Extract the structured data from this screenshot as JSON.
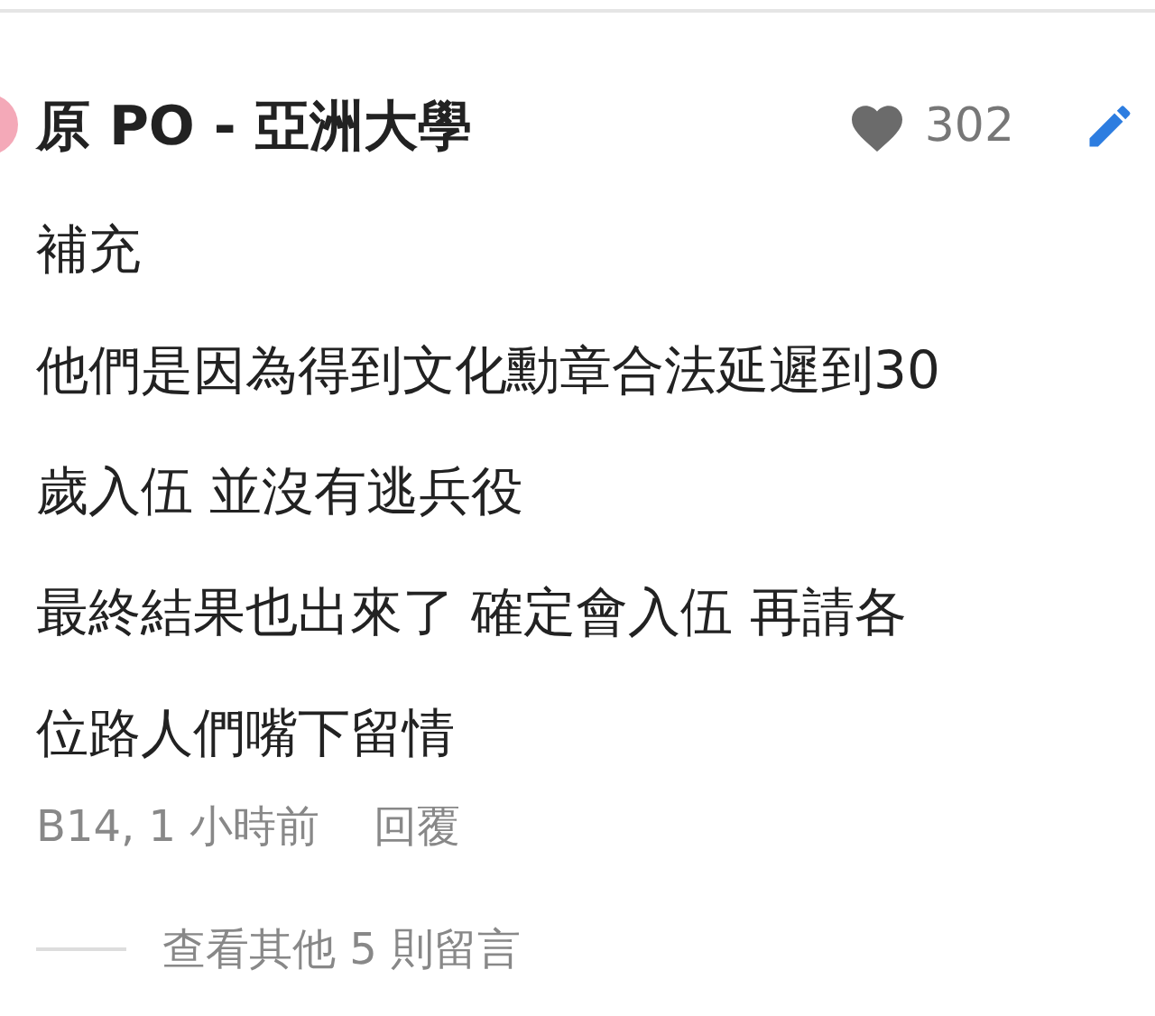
{
  "comment": {
    "author": "原 PO - 亞洲大學",
    "likes": "302",
    "lines": [
      "補充",
      "他們是因為得到文化勳章合法延遲到30",
      "歲入伍 並沒有逃兵役",
      "最終結果也出來了 確定會入伍 再請各",
      "位路人們嘴下留情"
    ],
    "floor": "B14, 1 小時前",
    "reply": "回覆"
  },
  "more_replies": "查看其他 5 則留言"
}
